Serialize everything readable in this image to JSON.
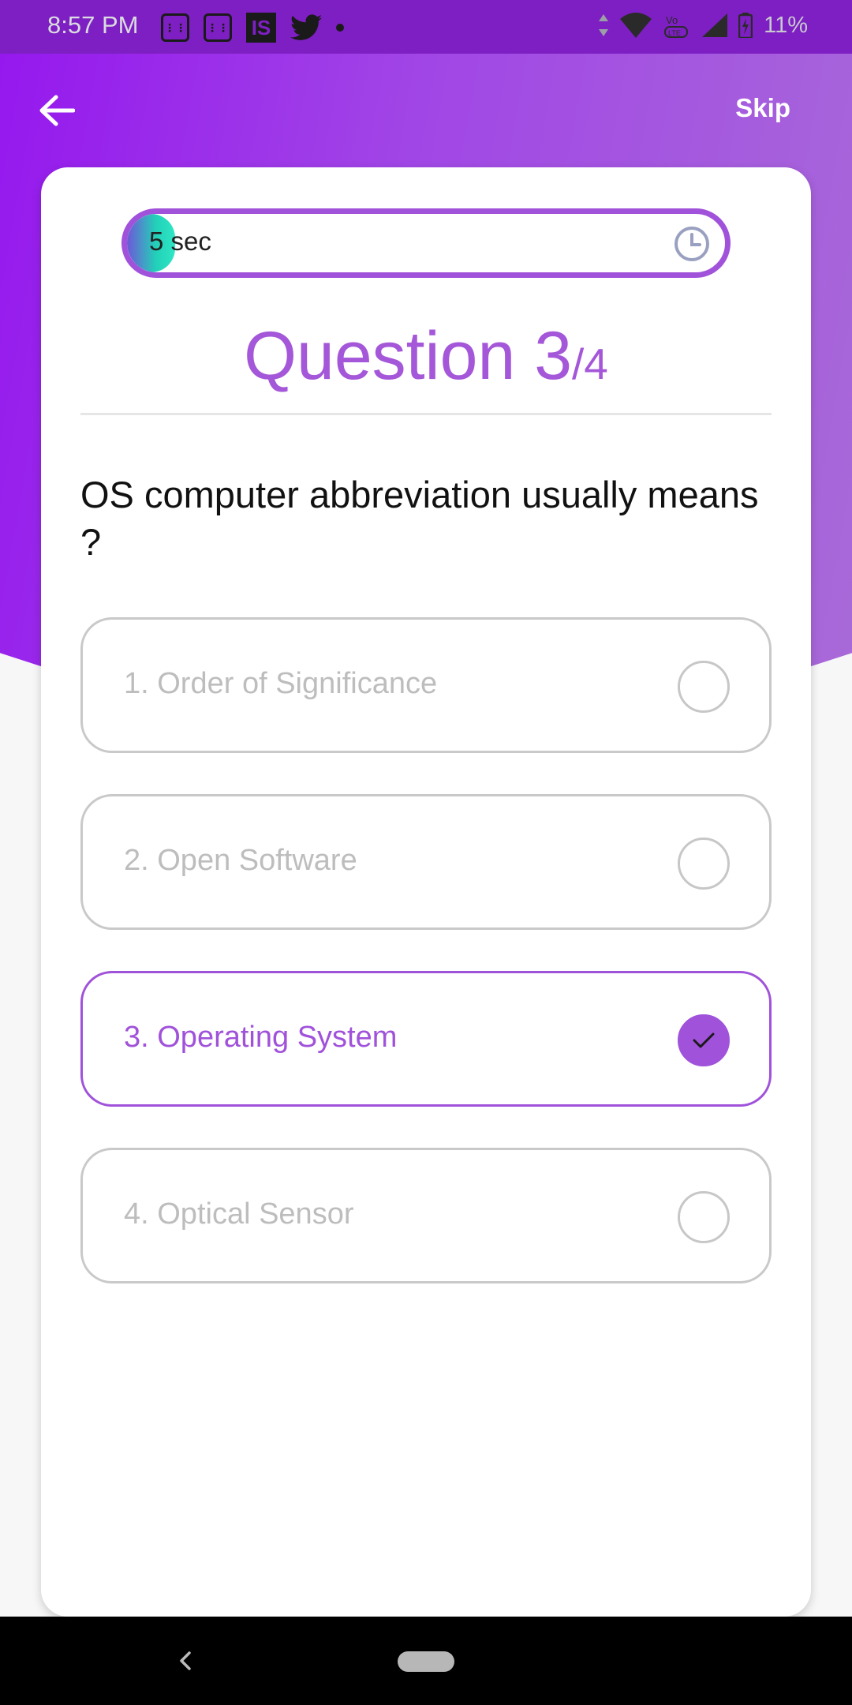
{
  "status_bar": {
    "time": "8:57 PM",
    "battery": "11%",
    "notification_icons": [
      "app-grid-icon",
      "app-grid-icon",
      "is-app-icon",
      "twitter-icon",
      "more-dot-icon"
    ],
    "system_icons": [
      "data-arrows-icon",
      "wifi-icon",
      "volte-icon",
      "signal-icon",
      "battery-icon"
    ]
  },
  "header": {
    "back_icon": "arrow-left-icon",
    "skip_label": "Skip"
  },
  "timer": {
    "label": "5 sec",
    "progress": 0.08,
    "icon": "clock-icon",
    "colors": {
      "border": "#a052da",
      "fill_start": "#6e57d8",
      "fill_end": "#2ee6c4"
    }
  },
  "question": {
    "prefix": "Question 3",
    "total": "/4",
    "text": "OS computer abbreviation usually means ?"
  },
  "options": [
    {
      "label": "1. Order of Significance",
      "selected": false
    },
    {
      "label": "2. Open Software",
      "selected": false
    },
    {
      "label": "3. Operating System",
      "selected": true
    },
    {
      "label": "4. Optical Sensor",
      "selected": false
    }
  ],
  "theme": {
    "accent": "#a052da",
    "header_gradient_start": "#9517ee",
    "header_gradient_end": "#a86ad8"
  }
}
